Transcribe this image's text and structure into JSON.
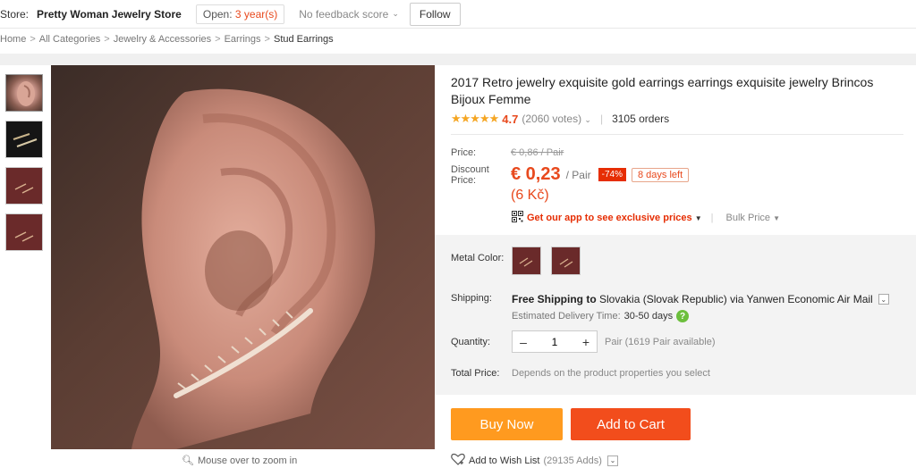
{
  "store": {
    "label": "Store:",
    "name": "Pretty Woman Jewelry Store",
    "open_prefix": "Open:",
    "open_years": "3 year(s)",
    "feedback": "No feedback score",
    "follow": "Follow"
  },
  "breadcrumb": [
    "Home",
    "All Categories",
    "Jewelry & Accessories",
    "Earrings",
    "Stud Earrings"
  ],
  "gallery": {
    "zoom_hint": "Mouse over to zoom in"
  },
  "product": {
    "title": "2017 Retro jewelry exquisite gold earrings earrings exquisite jewelry Brincos Bijoux Femme",
    "rating": "4.7",
    "stars": "★★★★★",
    "votes": "(2060 votes)",
    "orders": "3105 orders"
  },
  "pricing": {
    "price_label": "Price:",
    "old_price": "€ 0,86 / Pair",
    "discount_label_1": "Discount",
    "discount_label_2": "Price:",
    "price": "€ 0,23",
    "unit": "/ Pair",
    "discount": "-74%",
    "days_left": "8 days left",
    "local_price": "(6 Kč)",
    "app_prices": "Get our app to see exclusive prices",
    "bulk_price": "Bulk Price"
  },
  "options": {
    "metal_color_label": "Metal Color:",
    "shipping_label": "Shipping:",
    "shipping_free": "Free Shipping to",
    "shipping_rest": "Slovakia (Slovak Republic) via Yanwen Economic Air Mail",
    "delivery_label": "Estimated Delivery Time:",
    "delivery_days": "30-50 days",
    "quantity_label": "Quantity:",
    "quantity_value": "1",
    "available": "Pair (1619 Pair available)",
    "total_label": "Total Price:",
    "total_value": "Depends on the product properties you select"
  },
  "actions": {
    "buy_now": "Buy Now",
    "add_to_cart": "Add to Cart",
    "wish_list": "Add to Wish List",
    "wish_adds": "(29135 Adds)"
  },
  "colors": {
    "accent": "#e8491d",
    "buy_now": "#ff9a1f",
    "add_to_cart": "#f24d1c",
    "swatch": "#6a2a2a"
  }
}
